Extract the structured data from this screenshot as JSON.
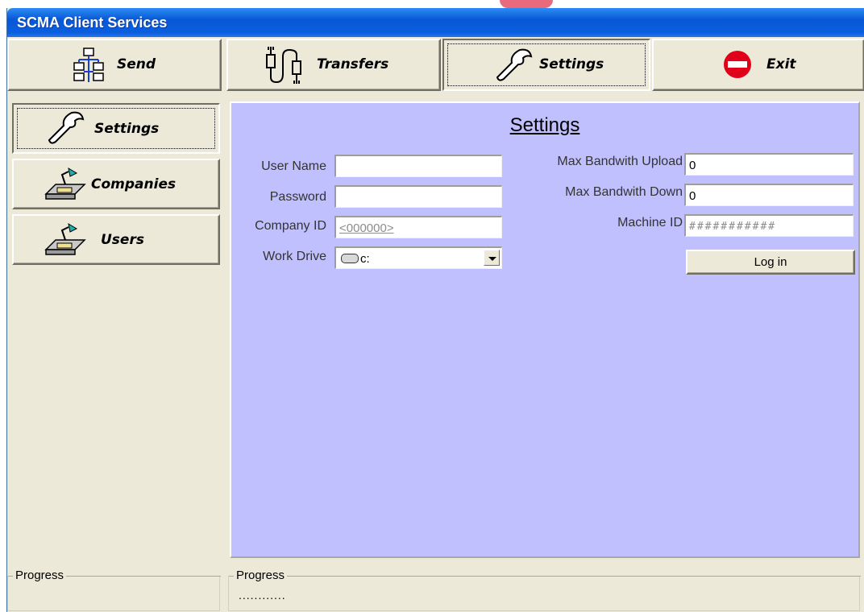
{
  "window": {
    "title": "SCMA Client Services"
  },
  "toolbar": {
    "send": "Send",
    "transfers": "Transfers",
    "settings": "Settings",
    "exit": "Exit"
  },
  "sidebar": {
    "items": [
      {
        "label": "Settings",
        "icon": "wrench-icon",
        "selected": true
      },
      {
        "label": "Companies",
        "icon": "desk-lamp-icon",
        "selected": false
      },
      {
        "label": "Users",
        "icon": "desk-lamp-icon",
        "selected": false
      }
    ]
  },
  "settings": {
    "title": "Settings",
    "user_name_label": "User Name",
    "user_name_value": "",
    "password_label": "Password",
    "password_value": "",
    "company_id_label": "Company ID",
    "company_id_value": "<000000>",
    "work_drive_label": "Work Drive",
    "work_drive_value": "c:",
    "max_upload_label": "Max Bandwith Upload",
    "max_upload_value": "0",
    "max_down_label": "Max Bandwith Down",
    "max_down_value": "0",
    "machine_id_label": "Machine ID",
    "machine_id_value": "###########",
    "login_button": "Log in"
  },
  "status": {
    "left_title": "Progress",
    "right_title": "Progress",
    "right_value": "............"
  },
  "colors": {
    "panel_bg": "#c0c0ff",
    "window_bg": "#ece9d8",
    "titlebar": "#0a5fde",
    "exit_icon": "#e0001a"
  }
}
